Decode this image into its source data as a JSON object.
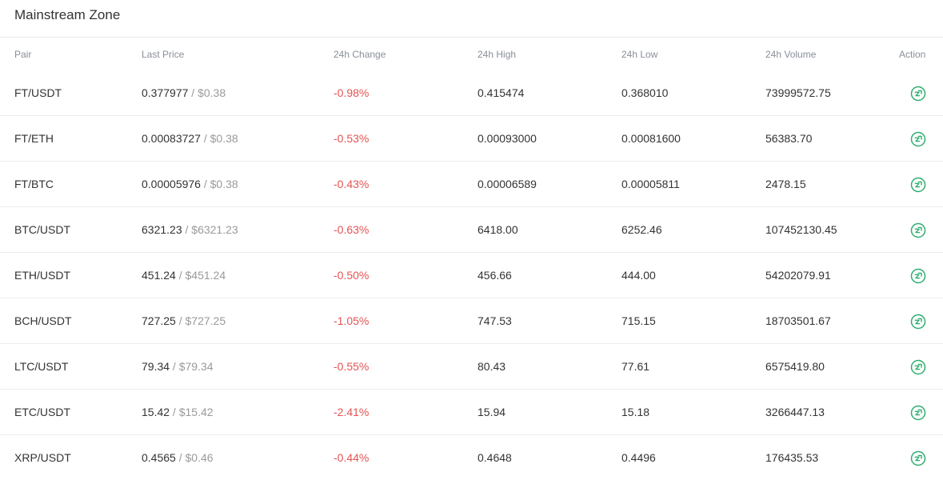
{
  "title": "Mainstream Zone",
  "colors": {
    "negative": "#e55353",
    "action": "#2fae6f",
    "muted": "#9a9a9a"
  },
  "columns": {
    "pair": "Pair",
    "last_price": "Last Price",
    "change": "24h Change",
    "high": "24h High",
    "low": "24h Low",
    "volume": "24h Volume",
    "action": "Action"
  },
  "price_separator": " / ",
  "action_icon": "trade-exchange-icon",
  "rows": [
    {
      "pair": "FT/USDT",
      "price": "0.377977",
      "usd": "$0.38",
      "change": "-0.98%",
      "high": "0.415474",
      "low": "0.368010",
      "volume": "73999572.75"
    },
    {
      "pair": "FT/ETH",
      "price": "0.00083727",
      "usd": "$0.38",
      "change": "-0.53%",
      "high": "0.00093000",
      "low": "0.00081600",
      "volume": "56383.70"
    },
    {
      "pair": "FT/BTC",
      "price": "0.00005976",
      "usd": "$0.38",
      "change": "-0.43%",
      "high": "0.00006589",
      "low": "0.00005811",
      "volume": "2478.15"
    },
    {
      "pair": "BTC/USDT",
      "price": "6321.23",
      "usd": "$6321.23",
      "change": "-0.63%",
      "high": "6418.00",
      "low": "6252.46",
      "volume": "107452130.45"
    },
    {
      "pair": "ETH/USDT",
      "price": "451.24",
      "usd": "$451.24",
      "change": "-0.50%",
      "high": "456.66",
      "low": "444.00",
      "volume": "54202079.91"
    },
    {
      "pair": "BCH/USDT",
      "price": "727.25",
      "usd": "$727.25",
      "change": "-1.05%",
      "high": "747.53",
      "low": "715.15",
      "volume": "18703501.67"
    },
    {
      "pair": "LTC/USDT",
      "price": "79.34",
      "usd": "$79.34",
      "change": "-0.55%",
      "high": "80.43",
      "low": "77.61",
      "volume": "6575419.80"
    },
    {
      "pair": "ETC/USDT",
      "price": "15.42",
      "usd": "$15.42",
      "change": "-2.41%",
      "high": "15.94",
      "low": "15.18",
      "volume": "3266447.13"
    },
    {
      "pair": "XRP/USDT",
      "price": "0.4565",
      "usd": "$0.46",
      "change": "-0.44%",
      "high": "0.4648",
      "low": "0.4496",
      "volume": "176435.53"
    }
  ]
}
